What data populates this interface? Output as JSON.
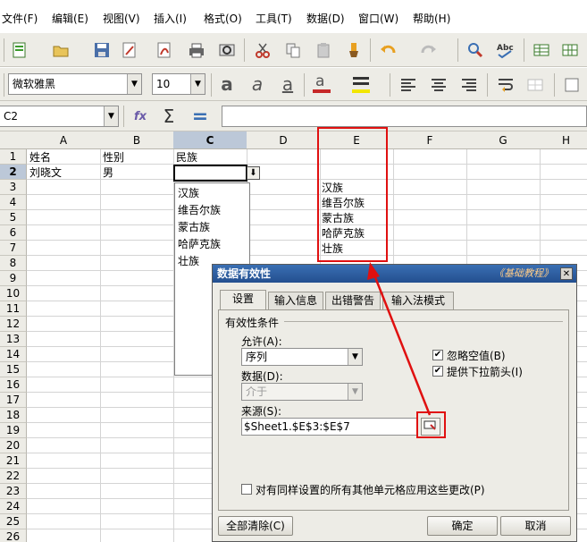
{
  "menu": [
    "文件(F)",
    "编辑(E)",
    "视图(V)",
    "插入(I)",
    "格式(O)",
    "工具(T)",
    "数据(D)",
    "窗口(W)",
    "帮助(H)"
  ],
  "toolbar": {
    "font_name": "微软雅黑",
    "font_size": "10"
  },
  "formula_bar": {
    "cell_ref": "C2",
    "fx_label": "fx",
    "sum_label": "Σ",
    "equals_label": "=",
    "content": ""
  },
  "columns": [
    "A",
    "B",
    "C",
    "D",
    "E",
    "F",
    "G",
    "H"
  ],
  "rows": [
    "1",
    "2",
    "3",
    "4",
    "5",
    "6",
    "7",
    "8",
    "9",
    "10",
    "11",
    "12",
    "13",
    "14",
    "15",
    "16",
    "17",
    "18",
    "19",
    "20",
    "21",
    "22",
    "23",
    "24",
    "25",
    "26"
  ],
  "cells": {
    "A1": "姓名",
    "B1": "性别",
    "C1": "民族",
    "A2": "刘晓文",
    "B2": "男",
    "E3": "汉族",
    "E4": "维吾尔族",
    "E5": "蒙古族",
    "E6": "哈萨克族",
    "E7": "壮族"
  },
  "validation_list": [
    "汉族",
    "维吾尔族",
    "蒙古族",
    "哈萨克族",
    "壮族"
  ],
  "dialog": {
    "title": "数据有效性",
    "watermark": "《基础教程》",
    "tabs": [
      "设置",
      "输入信息",
      "出错警告",
      "输入法模式"
    ],
    "group_label": "有效性条件",
    "allow_label": "允许(A):",
    "allow_value": "序列",
    "data_label": "数据(D):",
    "data_value": "介于",
    "source_label": "来源(S):",
    "source_value": "$Sheet1.$E$3:$E$7",
    "ignore_blank": "忽略空值(B)",
    "show_dropdown": "提供下拉箭头(I)",
    "apply_all": "对有同样设置的所有其他单元格应用这些更改(P)",
    "clear_all": "全部清除(C)",
    "ok": "确定",
    "cancel": "取消"
  },
  "colors": {
    "highlight_red": "#e01010",
    "title_blue": "#2c5ea0"
  }
}
